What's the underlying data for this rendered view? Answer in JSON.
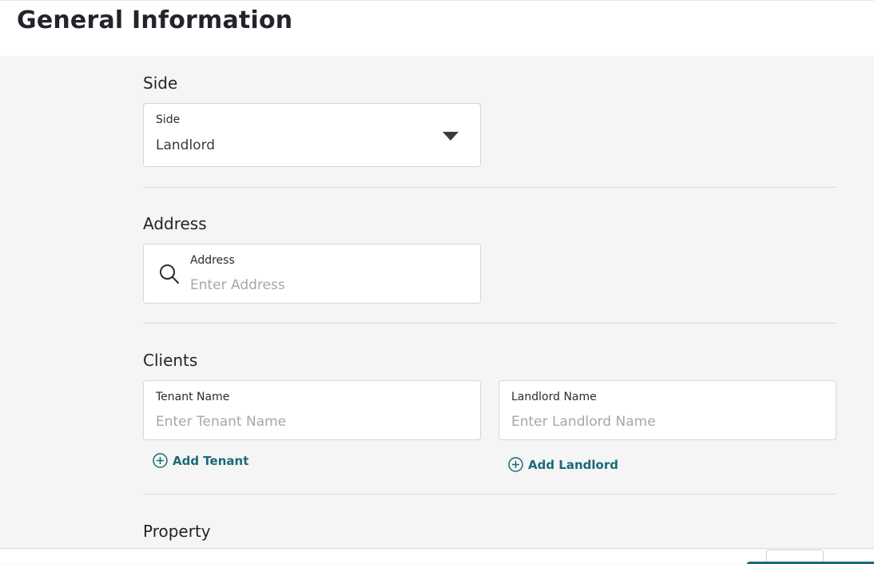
{
  "header": {
    "title": "General Information"
  },
  "side": {
    "section_title": "Side",
    "field_label": "Side",
    "selected_value": "Landlord"
  },
  "address": {
    "section_title": "Address",
    "field_label": "Address",
    "placeholder": "Enter Address"
  },
  "clients": {
    "section_title": "Clients",
    "tenant": {
      "field_label": "Tenant Name",
      "placeholder": "Enter Tenant Name",
      "add_label": "Add Tenant"
    },
    "landlord": {
      "field_label": "Landlord Name",
      "placeholder": "Enter Landlord Name",
      "add_label": "Add Landlord"
    }
  },
  "property": {
    "section_title": "Property"
  },
  "colors": {
    "accent": "#1b6a78",
    "background": "#f5f5f5",
    "text": "#23232b",
    "placeholder": "#a6a6ad"
  },
  "icons": {
    "dropdown": "caret-down-icon",
    "search": "search-icon",
    "add": "plus-circle-icon"
  }
}
